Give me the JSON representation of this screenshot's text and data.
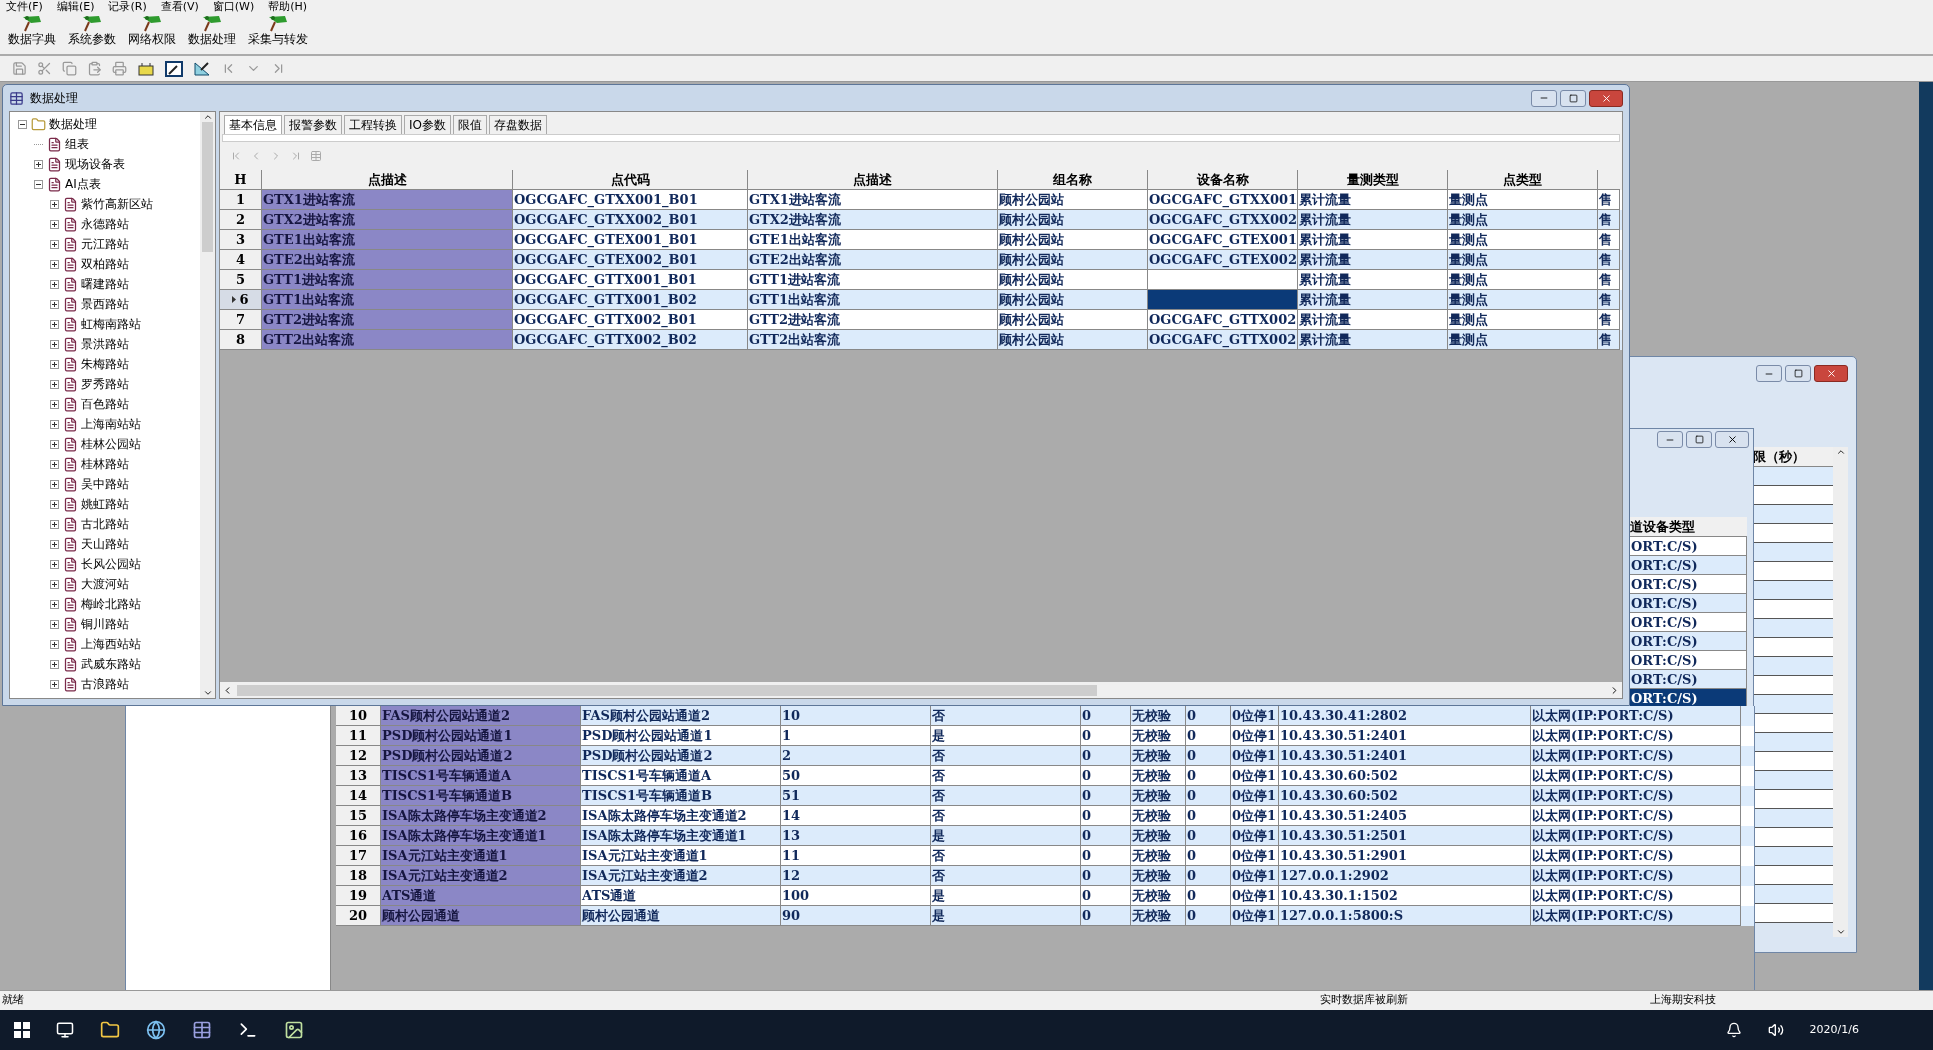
{
  "menu": [
    "文件(F)",
    "编辑(E)",
    "记录(R)",
    "查看(V)",
    "窗口(W)",
    "帮助(H)"
  ],
  "toolbar": [
    "数据字典",
    "系统参数",
    "网络权限",
    "数据处理",
    "采集与转发"
  ],
  "main_window": {
    "title": "数据处理",
    "tree": {
      "label": "数据处理",
      "kind": "folder",
      "expanded": true,
      "children": [
        {
          "label": "组表",
          "kind": "leaf"
        },
        {
          "label": "现场设备表",
          "kind": "node",
          "expanded": false
        },
        {
          "label": "AI点表",
          "kind": "node",
          "expanded": true,
          "children": [
            {
              "label": "紫竹高新区站",
              "kind": "node",
              "expanded": false
            },
            {
              "label": "永德路站",
              "kind": "node",
              "expanded": false
            },
            {
              "label": "元江路站",
              "kind": "node",
              "expanded": false
            },
            {
              "label": "双柏路站",
              "kind": "node",
              "expanded": false
            },
            {
              "label": "曙建路站",
              "kind": "node",
              "expanded": false
            },
            {
              "label": "景西路站",
              "kind": "node",
              "expanded": false
            },
            {
              "label": "虹梅南路站",
              "kind": "node",
              "expanded": false
            },
            {
              "label": "景洪路站",
              "kind": "node",
              "expanded": false
            },
            {
              "label": "朱梅路站",
              "kind": "node",
              "expanded": false
            },
            {
              "label": "罗秀路站",
              "kind": "node",
              "expanded": false
            },
            {
              "label": "百色路站",
              "kind": "node",
              "expanded": false
            },
            {
              "label": "上海南站站",
              "kind": "node",
              "expanded": false
            },
            {
              "label": "桂林公园站",
              "kind": "node",
              "expanded": false
            },
            {
              "label": "桂林路站",
              "kind": "node",
              "expanded": false
            },
            {
              "label": "吴中路站",
              "kind": "node",
              "expanded": false
            },
            {
              "label": "姚虹路站",
              "kind": "node",
              "expanded": false
            },
            {
              "label": "古北路站",
              "kind": "node",
              "expanded": false
            },
            {
              "label": "天山路站",
              "kind": "node",
              "expanded": false
            },
            {
              "label": "长风公园站",
              "kind": "node",
              "expanded": false
            },
            {
              "label": "大渡河站",
              "kind": "node",
              "expanded": false
            },
            {
              "label": "梅岭北路站",
              "kind": "node",
              "expanded": false
            },
            {
              "label": "铜川路站",
              "kind": "node",
              "expanded": false
            },
            {
              "label": "上海西站站",
              "kind": "node",
              "expanded": false
            },
            {
              "label": "武威东路站",
              "kind": "node",
              "expanded": false
            },
            {
              "label": "古浪路站",
              "kind": "node",
              "expanded": false
            }
          ]
        }
      ]
    },
    "tabs": [
      {
        "label": "基本信息",
        "selected": true
      },
      {
        "label": "报警参数",
        "selected": false
      },
      {
        "label": "工程转换",
        "selected": false
      },
      {
        "label": "IO参数",
        "selected": false
      },
      {
        "label": "限值",
        "selected": false
      },
      {
        "label": "存盘数据",
        "selected": false
      }
    ],
    "table": {
      "columns": [
        "H",
        "点描述",
        "点代码",
        "点描述",
        "组名称",
        "设备名称",
        "量测类型",
        "点类型"
      ],
      "rows": [
        {
          "selected": false,
          "cells": [
            "1",
            "GTX1进站客流",
            "OGCGAFC_GTXX001_B01",
            "GTX1进站客流",
            "顾村公园站",
            "OGCGAFC_GTXX001",
            "累计流量",
            "量测点",
            "售"
          ]
        },
        {
          "selected": false,
          "cells": [
            "2",
            "GTX2进站客流",
            "OGCGAFC_GTXX002_B01",
            "GTX2进站客流",
            "顾村公园站",
            "OGCGAFC_GTXX002",
            "累计流量",
            "量测点",
            "售"
          ]
        },
        {
          "selected": false,
          "cells": [
            "3",
            "GTE1出站客流",
            "OGCGAFC_GTEX001_B01",
            "GTE1出站客流",
            "顾村公园站",
            "OGCGAFC_GTEX001",
            "累计流量",
            "量测点",
            "售"
          ]
        },
        {
          "selected": false,
          "cells": [
            "4",
            "GTE2出站客流",
            "OGCGAFC_GTEX002_B01",
            "GTE2出站客流",
            "顾村公园站",
            "OGCGAFC_GTEX002",
            "累计流量",
            "量测点",
            "售"
          ]
        },
        {
          "selected": false,
          "cells": [
            "5",
            "GTT1进站客流",
            "OGCGAFC_GTTX001_B01",
            "GTT1进站客流",
            "顾村公园站",
            {
              "focused": false
            },
            "累计流量",
            "量测点",
            "售"
          ]
        },
        {
          "selected": true,
          "cells": [
            "6",
            "GTT1出站客流",
            "OGCGAFC_GTTX001_B02",
            "GTT1出站客流",
            "顾村公园站",
            {
              "focused": true
            },
            "累计流量",
            "量测点",
            "售"
          ]
        },
        {
          "selected": false,
          "cells": [
            "7",
            "GTT2进站客流",
            "OGCGAFC_GTTX002_B01",
            "GTT2进站客流",
            "顾村公园站",
            "OGCGAFC_GTTX002",
            "累计流量",
            "量测点",
            "售"
          ]
        },
        {
          "selected": false,
          "cells": [
            "8",
            "GTT2出站客流",
            "OGCGAFC_GTTX002_B02",
            "GTT2出站客流",
            "顾村公园站",
            "OGCGAFC_GTTX002",
            "累计流量",
            "量测点",
            "售"
          ]
        }
      ]
    }
  },
  "timeout_window": {
    "column_header": "限（秒）"
  },
  "channel_window": {
    "column_header": "道设备类型",
    "column_tail": [
      {
        "text": "ORT:C/S)",
        "selected": false
      },
      {
        "text": "ORT:C/S)",
        "selected": false
      },
      {
        "text": "ORT:C/S)",
        "selected": false
      },
      {
        "text": "ORT:C/S)",
        "selected": false
      },
      {
        "text": "ORT:C/S)",
        "selected": false
      },
      {
        "text": "ORT:C/S)",
        "selected": false
      },
      {
        "text": "ORT:C/S)",
        "selected": false
      },
      {
        "text": "ORT:C/S)",
        "selected": false
      },
      {
        "text": "ORT:C/S)",
        "selected": true
      }
    ],
    "rows": [
      [
        "10",
        "FAS顾村公园站通道2",
        "FAS顾村公园站通道2",
        "10",
        "否",
        "0",
        "无校验",
        "0",
        "0位停1",
        "10.43.30.41:2802",
        "以太网(IP:PORT:C/S)"
      ],
      [
        "11",
        "PSD顾村公园站通道1",
        "PSD顾村公园站通道1",
        "1",
        "是",
        "0",
        "无校验",
        "0",
        "0位停1",
        "10.43.30.51:2401",
        "以太网(IP:PORT:C/S)"
      ],
      [
        "12",
        "PSD顾村公园站通道2",
        "PSD顾村公园站通道2",
        "2",
        "否",
        "0",
        "无校验",
        "0",
        "0位停1",
        "10.43.30.51:2401",
        "以太网(IP:PORT:C/S)"
      ],
      [
        "13",
        "TISCS1号车辆通道A",
        "TISCS1号车辆通道A",
        "50",
        "否",
        "0",
        "无校验",
        "0",
        "0位停1",
        "10.43.30.60:502",
        "以太网(IP:PORT:C/S)"
      ],
      [
        "14",
        "TISCS1号车辆通道B",
        "TISCS1号车辆通道B",
        "51",
        "否",
        "0",
        "无校验",
        "0",
        "0位停1",
        "10.43.30.60:502",
        "以太网(IP:PORT:C/S)"
      ],
      [
        "15",
        "ISA陈太路停车场主变通道2",
        "ISA陈太路停车场主变通道2",
        "14",
        "否",
        "0",
        "无校验",
        "0",
        "0位停1",
        "10.43.30.51:2405",
        "以太网(IP:PORT:C/S)"
      ],
      [
        "16",
        "ISA陈太路停车场主变通道1",
        "ISA陈太路停车场主变通道1",
        "13",
        "是",
        "0",
        "无校验",
        "0",
        "0位停1",
        "10.43.30.51:2501",
        "以太网(IP:PORT:C/S)"
      ],
      [
        "17",
        "ISA元江站主变通道1",
        "ISA元江站主变通道1",
        "11",
        "否",
        "0",
        "无校验",
        "0",
        "0位停1",
        "10.43.30.51:2901",
        "以太网(IP:PORT:C/S)"
      ],
      [
        "18",
        "ISA元江站主变通道2",
        "ISA元江站主变通道2",
        "12",
        "否",
        "0",
        "无校验",
        "0",
        "0位停1",
        "127.0.0.1:2902",
        "以太网(IP:PORT:C/S)"
      ],
      [
        "19",
        "ATS通道",
        "ATS通道",
        "100",
        "是",
        "0",
        "无校验",
        "0",
        "0位停1",
        "10.43.30.1:1502",
        "以太网(IP:PORT:C/S)"
      ],
      [
        "20",
        "顾村公园通道",
        "顾村公园通道",
        "90",
        "是",
        "0",
        "无校验",
        "0",
        "0位停1",
        "127.0.0.1:5800:S",
        "以太网(IP:PORT:C/S)"
      ]
    ]
  },
  "status_bar": [
    "就绪",
    "实时数据库被刷新",
    "上海期安科技"
  ],
  "taskbar": {
    "date": "2020/1/6"
  }
}
